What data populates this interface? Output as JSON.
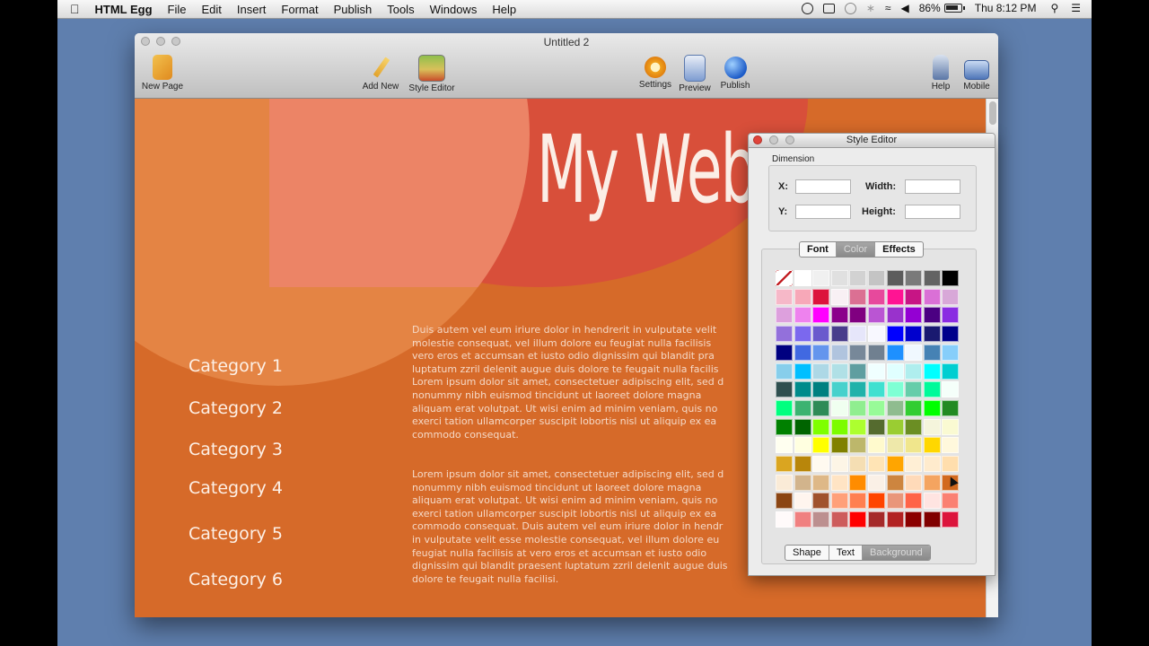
{
  "menubar": {
    "app_name": "HTML Egg",
    "items": [
      "File",
      "Edit",
      "Insert",
      "Format",
      "Publish",
      "Tools",
      "Windows",
      "Help"
    ],
    "battery": "86%",
    "clock": "Thu 8:12 PM"
  },
  "window": {
    "title": "Untitled 2",
    "toolbar": {
      "new_page": "New Page",
      "add_new": "Add New",
      "style_editor": "Style Editor",
      "settings": "Settings",
      "preview": "Preview",
      "publish": "Publish",
      "help": "Help",
      "mobile": "Mobile"
    }
  },
  "site": {
    "title": "My Web",
    "categories": [
      "Category 1",
      "Category 2",
      "Category 3",
      "Category 4",
      "Category 5",
      "Category 6"
    ],
    "paragraph1_lines": [
      "Duis autem vel eum iriure dolor in hendrerit in vulputate velit",
      "molestie consequat, vel illum dolore eu feugiat nulla facilisis",
      "vero eros et accumsan et iusto odio dignissim qui blandit pra",
      "luptatum zzril delenit augue duis dolore te feugait nulla facilis",
      "Lorem ipsum dolor sit amet, consectetuer adipiscing elit, sed d",
      "nonummy nibh euismod tincidunt ut laoreet dolore magna",
      "aliquam erat volutpat. Ut wisi enim ad minim veniam, quis no",
      "exerci tation ullamcorper suscipit lobortis nisl ut aliquip ex ea",
      "commodo consequat."
    ],
    "paragraph2_lines": [
      "Lorem ipsum dolor sit amet, consectetuer adipiscing elit, sed d",
      "nonummy nibh euismod tincidunt ut laoreet dolore magna",
      "aliquam erat volutpat. Ut wisi enim ad minim veniam, quis no",
      "exerci tation ullamcorper suscipit lobortis nisl ut aliquip ex ea",
      "commodo consequat. Duis autem vel eum iriure dolor in hendr",
      "in vulputate velit esse molestie consequat, vel illum dolore eu",
      "feugiat nulla facilisis at vero eros et accumsan et iusto odio",
      "dignissim qui blandit praesent luptatum zzril delenit augue duis",
      "dolore te feugait nulla facilisi."
    ]
  },
  "style_editor": {
    "title": "Style Editor",
    "dimension_label": "Dimension",
    "x_label": "X:",
    "y_label": "Y:",
    "width_label": "Width:",
    "height_label": "Height:",
    "x_value": "",
    "y_value": "",
    "width_value": "",
    "height_value": "",
    "tabs": [
      "Font",
      "Color",
      "Effects"
    ],
    "selected_tab": "Color",
    "targets": [
      "Shape",
      "Text",
      "Background"
    ],
    "selected_target": "Background",
    "palette": [
      [
        "none",
        "#ffffff",
        "#f0f0f0",
        "#e0e0e0",
        "#d2d2d2",
        "#c4c4c4",
        "#5c5c5c",
        "#7a7a7a",
        "#636363",
        "#000000"
      ],
      [
        "#f6b8c8",
        "#f7a8b8",
        "#dc143c",
        "#f8f0f4",
        "#db7093",
        "#e7499c",
        "#ff1493",
        "#c71585",
        "#da70d6",
        "#d8a8d8"
      ],
      [
        "#dda0dd",
        "#ee82ee",
        "#ff00ff",
        "#8b008b",
        "#800080",
        "#ba55d3",
        "#9932cc",
        "#9400d3",
        "#4b0082",
        "#8a2be2"
      ],
      [
        "#9370db",
        "#7b68ee",
        "#6a5acd",
        "#483d8b",
        "#e6e6fa",
        "#f8f8ff",
        "#0000ff",
        "#0000cd",
        "#191970",
        "#00008b"
      ],
      [
        "#000080",
        "#4169e1",
        "#6495ed",
        "#b0c4de",
        "#778899",
        "#708090",
        "#1e90ff",
        "#f0f8ff",
        "#4682b4",
        "#87cefa"
      ],
      [
        "#87ceeb",
        "#00bfff",
        "#add8e6",
        "#b0e0e6",
        "#5f9ea0",
        "#f0ffff",
        "#e0ffff",
        "#afeeee",
        "#00ffff",
        "#00ced1"
      ],
      [
        "#2f4f4f",
        "#008b8b",
        "#008080",
        "#48d1cc",
        "#20b2aa",
        "#40e0d0",
        "#7fffd4",
        "#66cdaa",
        "#00fa9a",
        "#f5fffa"
      ],
      [
        "#00ff7f",
        "#3cb371",
        "#2e8b57",
        "#f0fff0",
        "#90ee90",
        "#98fb98",
        "#8fbc8f",
        "#32cd32",
        "#00ff00",
        "#228b22"
      ],
      [
        "#008000",
        "#006400",
        "#7fff00",
        "#7cfc00",
        "#adff2f",
        "#556b2f",
        "#9acd32",
        "#6b8e23",
        "#f5f5dc",
        "#fafad2"
      ],
      [
        "#fffff0",
        "#ffffe0",
        "#ffff00",
        "#808000",
        "#bdb76b",
        "#fffacd",
        "#eee8aa",
        "#f0e68c",
        "#ffd700",
        "#fff8dc"
      ],
      [
        "#daa520",
        "#b8860b",
        "#fffaf0",
        "#fdf5e6",
        "#f5deb3",
        "#ffe4b5",
        "#ffa500",
        "#ffefd5",
        "#ffebcd",
        "#ffdead"
      ],
      [
        "#faebd7",
        "#d2b48c",
        "#deb887",
        "#ffe4c4",
        "#ff8c00",
        "#faf0e6",
        "#cd853f",
        "#ffdab9",
        "#f4a460",
        "#d2691e"
      ],
      [
        "#8b4513",
        "#fff5ee",
        "#a0522d",
        "#ffa07a",
        "#ff7f50",
        "#ff4500",
        "#e9967a",
        "#ff6347",
        "#ffe4e1",
        "#fa8072"
      ],
      [
        "#fffafa",
        "#f08080",
        "#bc8f8f",
        "#cd5c5c",
        "#ff0000",
        "#a52a2a",
        "#b22222",
        "#8b0000",
        "#800000",
        "#dc143c"
      ]
    ]
  }
}
